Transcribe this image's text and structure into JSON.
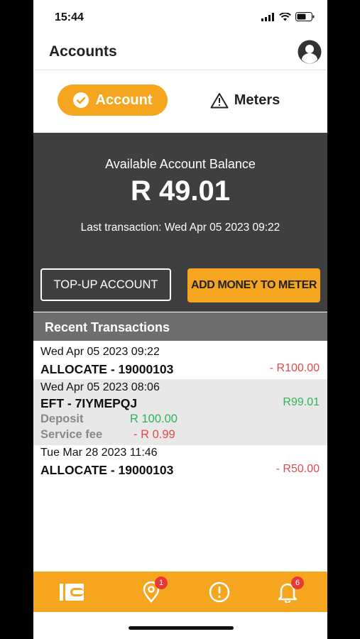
{
  "status_bar": {
    "time": "15:44"
  },
  "header": {
    "title": "Accounts"
  },
  "tabs": {
    "account": "Account",
    "meters": "Meters"
  },
  "balance": {
    "label": "Available Account Balance",
    "value": "R 49.01",
    "last_transaction": "Last transaction: Wed Apr 05 2023 09:22"
  },
  "actions": {
    "topup": "TOP-UP ACCOUNT",
    "add_money": "ADD MONEY TO METER"
  },
  "recent": {
    "title": "Recent Transactions",
    "transactions": [
      {
        "date": "Wed Apr 05 2023 09:22",
        "title": "ALLOCATE - 19000103",
        "amount": "- R100.00"
      },
      {
        "date": "Wed Apr 05 2023 08:06",
        "title": "EFT - 7IYMEPQJ",
        "amount": "R99.01",
        "deposit_label": "Deposit",
        "deposit_value": "R 100.00",
        "fee_label": "Service fee",
        "fee_value": "- R 0.99"
      },
      {
        "date": "Tue Mar 28 2023 11:46",
        "title": "ALLOCATE - 19000103",
        "amount": "- R50.00"
      }
    ]
  },
  "nav": {
    "items": [
      {
        "icon": "wallet-icon"
      },
      {
        "icon": "location-icon",
        "badge": "1"
      },
      {
        "icon": "alert-icon"
      },
      {
        "icon": "bell-icon",
        "badge": "6"
      }
    ]
  },
  "colors": {
    "accent": "#f6a51e",
    "panel": "#3f3f3f",
    "negative": "#e34949",
    "positive": "#2fb35a"
  }
}
